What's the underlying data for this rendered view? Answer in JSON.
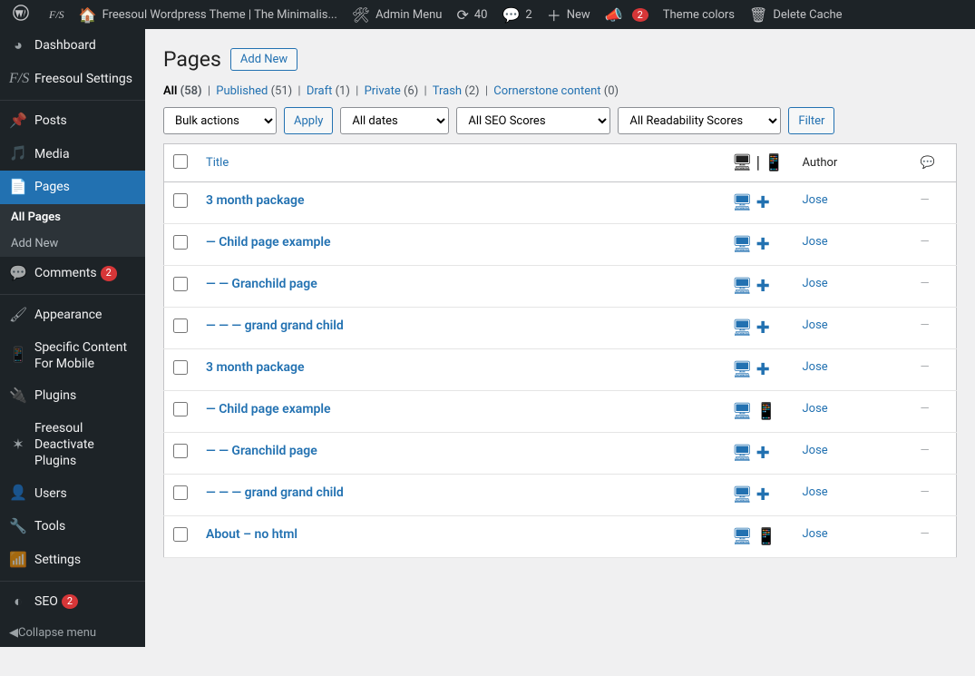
{
  "adminbar": {
    "site_name": "Freesoul Wordpress Theme | The Minimalis...",
    "admin_menu": "Admin Menu",
    "refresh_count": "40",
    "comments_count": "2",
    "new_label": "New",
    "notice_count": "2",
    "theme_colors": "Theme colors",
    "delete_cache": "Delete Cache"
  },
  "sidebar": {
    "dashboard": "Dashboard",
    "freesoul_settings": "Freesoul Settings",
    "posts": "Posts",
    "media": "Media",
    "pages": "Pages",
    "all_pages": "All Pages",
    "add_new": "Add New",
    "comments": "Comments",
    "comments_badge": "2",
    "appearance": "Appearance",
    "specific_content": "Specific Content For Mobile",
    "plugins": "Plugins",
    "freesoul_deactivate": "Freesoul Deactivate Plugins",
    "users": "Users",
    "tools": "Tools",
    "settings": "Settings",
    "seo": "SEO",
    "seo_badge": "2",
    "collapse": "Collapse menu"
  },
  "page": {
    "title": "Pages",
    "add_new": "Add New"
  },
  "views": {
    "all": {
      "label": "All",
      "count": "(58)"
    },
    "published": {
      "label": "Published",
      "count": "(51)"
    },
    "draft": {
      "label": "Draft",
      "count": "(1)"
    },
    "private": {
      "label": "Private",
      "count": "(6)"
    },
    "trash": {
      "label": "Trash",
      "count": "(2)"
    },
    "cornerstone": {
      "label": "Cornerstone content",
      "count": "(0)"
    }
  },
  "filters": {
    "bulk_actions": "Bulk actions",
    "apply": "Apply",
    "all_dates": "All dates",
    "seo_scores": "All SEO Scores",
    "readability": "All Readability Scores",
    "filter": "Filter"
  },
  "columns": {
    "title": "Title",
    "author": "Author"
  },
  "rows": [
    {
      "title": "3 month package",
      "author": "Jose",
      "icons": "dp"
    },
    {
      "title": "— Child page example",
      "author": "Jose",
      "icons": "dp"
    },
    {
      "title": "— — Granchild page",
      "author": "Jose",
      "icons": "dp"
    },
    {
      "title": "— — — grand grand child",
      "author": "Jose",
      "icons": "dp"
    },
    {
      "title": "3 month package",
      "author": "Jose",
      "icons": "dp"
    },
    {
      "title": "— Child page example",
      "author": "Jose",
      "icons": "dm"
    },
    {
      "title": "— — Granchild page",
      "author": "Jose",
      "icons": "dp"
    },
    {
      "title": "— — — grand grand child",
      "author": "Jose",
      "icons": "dp"
    },
    {
      "title": "About – no html",
      "author": "Jose",
      "icons": "dm"
    }
  ]
}
